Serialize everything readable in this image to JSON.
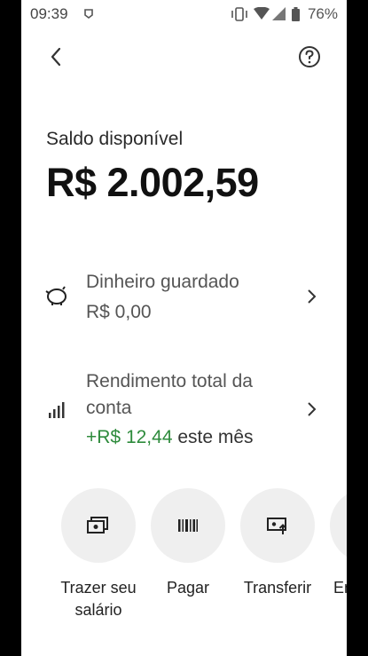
{
  "status_bar": {
    "time": "09:39",
    "battery": "76%",
    "icons": [
      "notification-icon",
      "vibrate-icon",
      "wifi-icon",
      "signal-icon",
      "battery-icon"
    ]
  },
  "nav": {
    "back_icon": "chevron-left-icon",
    "help_icon": "help-circle-icon"
  },
  "balance": {
    "label": "Saldo disponível",
    "value": "R$ 2.002,59"
  },
  "saved": {
    "label": "Dinheiro guardado",
    "value": "R$ 0,00",
    "icon": "piggy-bank-icon"
  },
  "yield": {
    "label_line1": "Rendimento total da",
    "label_line2": "conta",
    "amount": "+R$ 12,44",
    "suffix": "este mês",
    "icon": "bar-chart-icon",
    "amount_color": "#2e8b3c"
  },
  "actions": [
    {
      "label_line1": "Trazer seu",
      "label_line2": "salário",
      "icon": "deposit-icon"
    },
    {
      "label_line1": "Pagar",
      "label_line2": "",
      "icon": "barcode-icon"
    },
    {
      "label_line1": "Transferir",
      "label_line2": "",
      "icon": "transfer-icon"
    },
    {
      "label_line1": "Em",
      "label_line2": "",
      "icon": "partial-icon"
    }
  ]
}
